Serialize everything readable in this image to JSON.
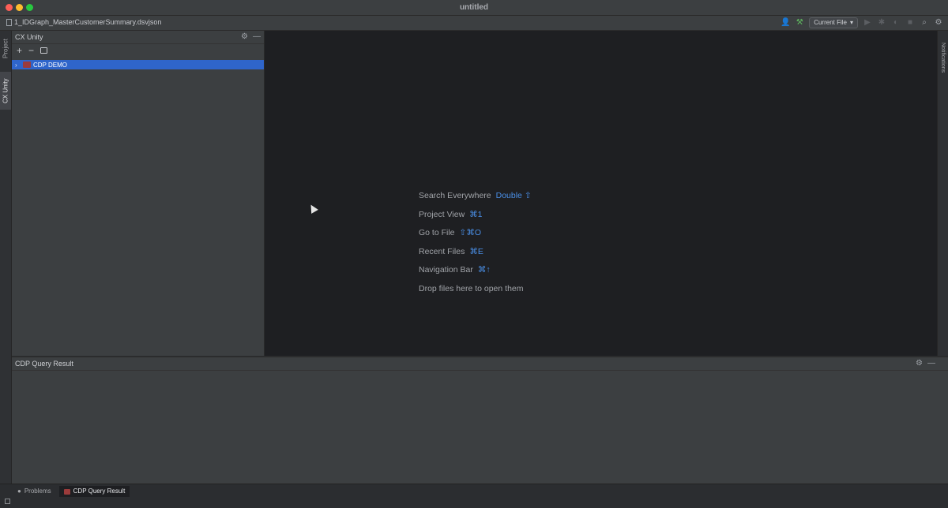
{
  "window": {
    "title": "untitled"
  },
  "toolbar": {
    "file_path": "1_IDGraph_MasterCustomerSummary.dsvjson",
    "run_config": "Current File"
  },
  "left_strip": {
    "tabs": [
      {
        "label": "Project"
      },
      {
        "label": "CX Unity"
      }
    ]
  },
  "right_strip": {
    "tabs": [
      {
        "label": "Notifications"
      }
    ]
  },
  "cx_panel": {
    "title": "CX Unity",
    "tree": [
      {
        "label": "CDP DEMO",
        "selected": true
      }
    ]
  },
  "editor": {
    "hints": [
      {
        "label": "Search Everywhere",
        "shortcut": "Double ⇧"
      },
      {
        "label": "Project View",
        "shortcut": "⌘1"
      },
      {
        "label": "Go to File",
        "shortcut": "⇧⌘O"
      },
      {
        "label": "Recent Files",
        "shortcut": "⌘E"
      },
      {
        "label": "Navigation Bar",
        "shortcut": "⌘↑"
      },
      {
        "label": "Drop files here to open them",
        "shortcut": ""
      }
    ]
  },
  "bottom_panel": {
    "title": "CDP Query Result"
  },
  "bottom_tabs": [
    {
      "label": "Problems",
      "active": false
    },
    {
      "label": "CDP Query Result",
      "active": true
    }
  ],
  "colors": {
    "accent": "#2f65ca",
    "shortcut_blue": "#4a8fe7",
    "editor_bg": "#1e1f22",
    "panel_bg": "#3c3f41"
  }
}
